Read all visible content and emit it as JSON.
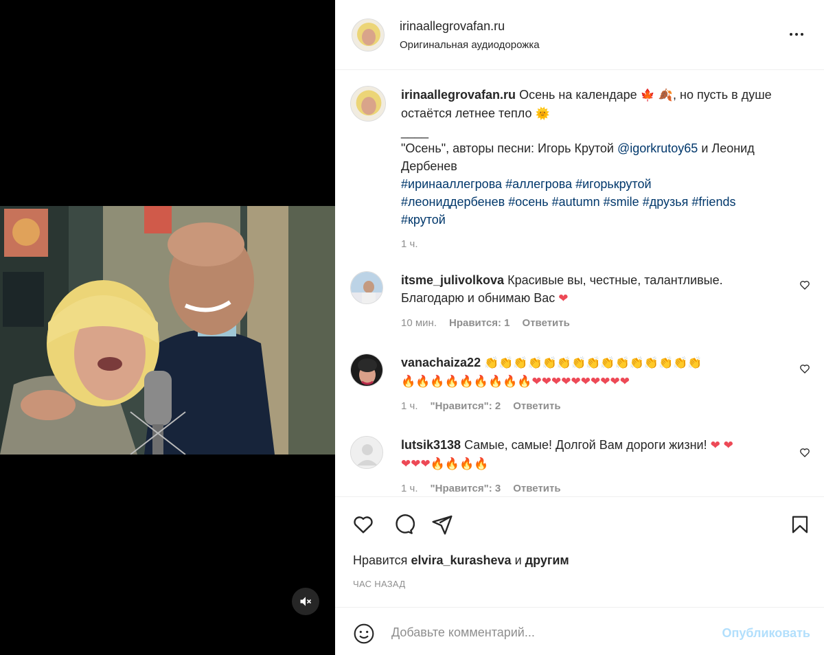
{
  "post": {
    "username": "irinaallegrovafan.ru",
    "audio": "Оригинальная аудиодорожка"
  },
  "caption": {
    "username": "irinaallegrovafan.ru",
    "text_1": "Осень на календаре",
    "text_2": ", но пусть в душе остаётся летнее тепло",
    "separator": "____",
    "line_2a": "\"Осень\", авторы песни: Игорь Крутой",
    "mention": "@igorkrutoy65",
    "line_2b": "и Леонид Дербенев",
    "hashtags": [
      "#ирinaаллегрова",
      "#аллегрова",
      "#игорькрутой",
      "#леониддербенев",
      "#осень",
      "#autumn",
      "#smile",
      "#друзья",
      "#friends",
      "#крутой"
    ],
    "time": "1 ч."
  },
  "comments": [
    {
      "username": "itsme_julivolkova",
      "text": "Красивые вы, честные, талантливые. Благодарю и обнимаю Вас",
      "time": "10 мин.",
      "likes": "Нравится: 1",
      "reply": "Ответить"
    },
    {
      "username": "vanachaiza22",
      "text": "",
      "time": "1 ч.",
      "likes": "\"Нравится\": 2",
      "reply": "Ответить"
    },
    {
      "username": "lutsik3138",
      "text": "Самые, самые! Долгой Вам дороги жизни!",
      "time": "1 ч.",
      "likes": "\"Нравится\": 3",
      "reply": "Ответить"
    }
  ],
  "likes": {
    "prefix": "Нравится",
    "user": "elvira_kurasheva",
    "and": "и",
    "others": "другим"
  },
  "time_ago": "ЧАС НАЗАД",
  "add_comment": {
    "placeholder": "Добавьте комментарий...",
    "publish": "Опубликовать"
  },
  "colors": {
    "link": "#00376b",
    "muted": "#8e8e8e",
    "publish_disabled": "#b2dffc",
    "heart_red": "#ed4956"
  }
}
